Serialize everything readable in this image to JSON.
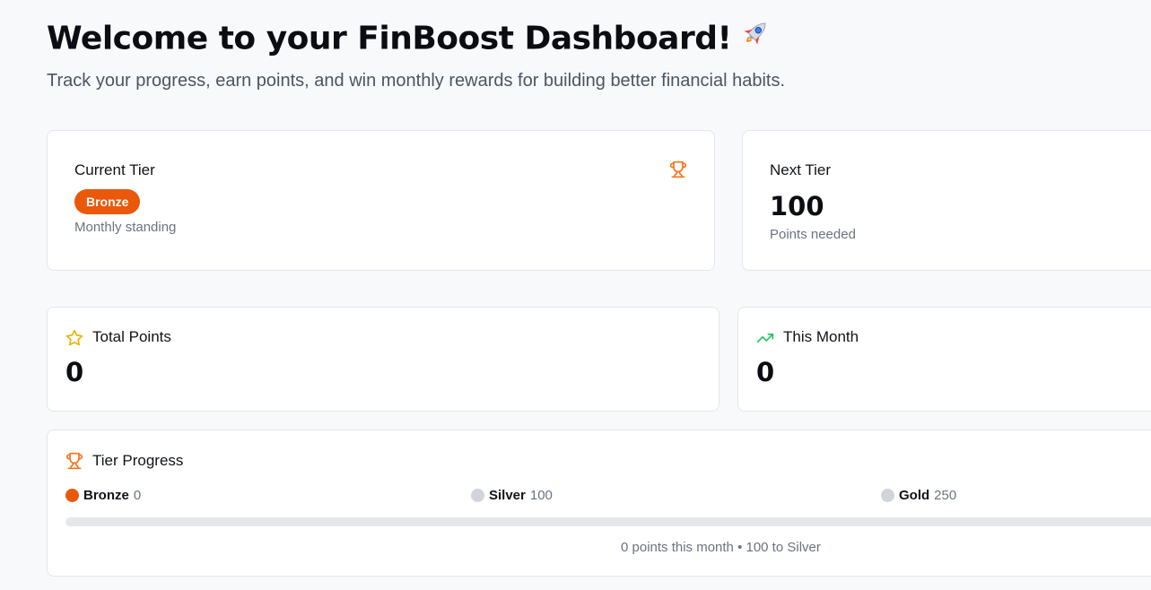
{
  "header": {
    "title": "Welcome to your FinBoost Dashboard!",
    "title_icon": "rocket-icon",
    "subtitle": "Track your progress, earn points, and win monthly rewards for building better financial habits."
  },
  "current_tier_card": {
    "label": "Current Tier",
    "icon": "trophy-icon",
    "tier": "Bronze",
    "caption": "Monthly standing"
  },
  "next_tier_card": {
    "label": "Next Tier",
    "value": "100",
    "caption": "Points needed"
  },
  "total_points_card": {
    "label": "Total Points",
    "icon": "star-icon",
    "value": "0"
  },
  "this_month_card": {
    "label": "This Month",
    "icon": "trending-up-icon",
    "value": "0"
  },
  "tier_progress": {
    "label": "Tier Progress",
    "icon": "trophy-icon",
    "tiers": [
      {
        "name": "Bronze",
        "points": "0",
        "color": "#ea580c",
        "reached": true
      },
      {
        "name": "Silver",
        "points": "100",
        "color": "#d1d5db",
        "reached": false
      },
      {
        "name": "Gold",
        "points": "250",
        "color": "#d1d5db",
        "reached": false
      }
    ],
    "progress_fraction": 0,
    "caption": "0 points this month • 100 to Silver"
  },
  "colors": {
    "accent": "#ea580c",
    "star": "#eab308",
    "trend": "#22c55e",
    "background": "#f8f9fb"
  }
}
